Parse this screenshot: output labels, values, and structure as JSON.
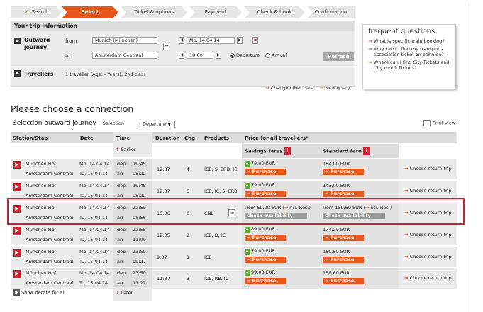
{
  "steps": [
    {
      "label": "Search",
      "done": true
    },
    {
      "label": "Select",
      "active": true
    },
    {
      "label": "Ticket & options"
    },
    {
      "label": "Payment"
    },
    {
      "label": "Check & book"
    },
    {
      "label": "Confirmation"
    }
  ],
  "trip": {
    "header": "Your trip information",
    "outward_label": "Outward journey",
    "from_label": "from",
    "to_label": "to",
    "from_value": "Munich (München)",
    "to_value": "Amsterdam Centraal",
    "date_value": "Mo, 14.04.14",
    "time_value": "18:00",
    "departure_label": "Departure",
    "arrival_label": "Arrival",
    "refresh_label": "Refresh",
    "travellers_label": "Travellers",
    "travellers_value": "1 traveller (Age: - Years), 2nd class",
    "change_other": "Change other data",
    "new_query": "New query"
  },
  "faq": {
    "title": "frequent questions",
    "items": [
      "What is specific-train booking?",
      "Why can't I find my transport-association ticket on bahn.de?",
      "Where can I find City-Tickets and City mobil Tickets?"
    ]
  },
  "main": {
    "title": "Please choose a connection",
    "selection_title": "Selection outward journey",
    "selection_sep": "-",
    "selection_label": "Selection",
    "selection_value": "Departure",
    "print_label": "Print view"
  },
  "table": {
    "headers": {
      "station": "Station/Stop",
      "date": "Date",
      "time": "Time",
      "duration": "Duration",
      "chg": "Chg.",
      "products": "Products",
      "price": "Price for all travellers*",
      "savings": "Savings fares",
      "standard": "Standard fare"
    },
    "earlier": "Earlier",
    "later": "Later",
    "show_details": "Show details for all",
    "dep": "dep",
    "arr": "arr",
    "purchase": "Purchase",
    "check_availability": "Check availability",
    "choose_return": "Choose return trip",
    "rows": [
      {
        "from": "München Hbf",
        "to": "Amsterdam Centraal",
        "d1": "Mo, 14.04.14",
        "d2": "Tu, 15.04.14",
        "t1": "19:45",
        "t2": "08:22",
        "dur": "12:37",
        "chg": "4",
        "prod": "ICE, S, ERB, IC",
        "sav": "79,00 EUR",
        "std": "164,00 EUR"
      },
      {
        "from": "München Hbf",
        "to": "Amsterdam Centraal",
        "d1": "Mo, 14.04.14",
        "d2": "Tu, 15.04.14",
        "t1": "19:45",
        "t2": "08:22",
        "dur": "12:37",
        "chg": "5",
        "prod": "ICE, IC, S, ERB",
        "sav": "79,00 EUR",
        "std": "143,00 EUR"
      },
      {
        "from": "München Hbf",
        "to": "Amsterdam Centraal",
        "d1": "Mo, 14.04.14",
        "d2": "Tu, 15.04.14",
        "t1": "22:50",
        "t2": "08:56",
        "dur": "10:06",
        "chg": "0",
        "prod": "CNL",
        "sav": "from 69,00 EUR",
        "std": "from 159,60 EUR",
        "incl": "incl. Res.)"
      },
      {
        "from": "München Hbf",
        "to": "Amsterdam Centraal",
        "d1": "Mo, 14.04.14",
        "d2": "Tu, 15.04.14",
        "t1": "22:55",
        "t2": "11:00",
        "dur": "12:05",
        "chg": "2",
        "prod": "ICE, D, IC",
        "sav": "89,00 EUR",
        "std": "174,20 EUR"
      },
      {
        "from": "München Hbf",
        "to": "Amsterdam Centraal",
        "d1": "Mo, 14.04.14",
        "d2": "Tu, 15.04.14",
        "t1": "23:50",
        "t2": "09:27",
        "dur": "9:37",
        "chg": "1",
        "prod": "ICE",
        "sav": "79,00 EUR",
        "std": "169,60 EUR"
      },
      {
        "from": "München Hbf",
        "to": "Amsterdam Centraal",
        "d1": "Mo, 14.04.14",
        "d2": "Tu, 15.04.14",
        "t1": "23:50",
        "t2": "11:27",
        "dur": "11:37",
        "chg": "3",
        "prod": "ICE, RB, IC",
        "sav": "99,00 EUR",
        "std": "158,60 EUR"
      }
    ]
  },
  "colors": {
    "accent": "#e8581c",
    "highlight": "#d21f2b",
    "panel": "#ebebeb"
  }
}
